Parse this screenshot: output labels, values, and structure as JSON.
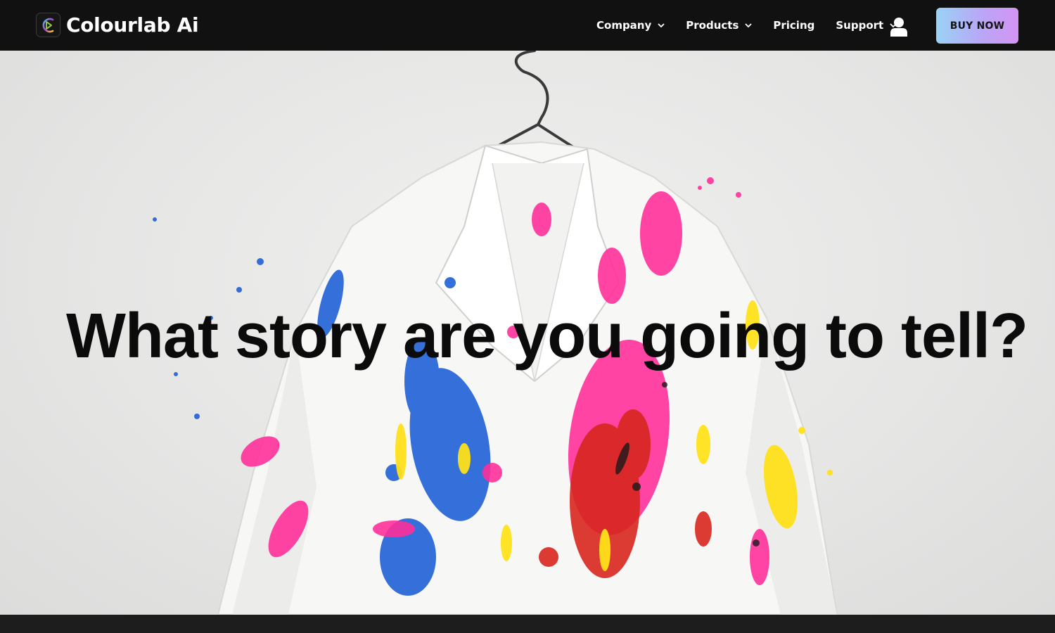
{
  "brand": {
    "name": "Colourlab Ai",
    "logo_icon": "colourlab-logo-icon"
  },
  "nav": {
    "items": [
      {
        "label": "Company",
        "has_dropdown": true
      },
      {
        "label": "Products",
        "has_dropdown": true
      },
      {
        "label": "Pricing",
        "has_dropdown": false
      },
      {
        "label": "Support",
        "has_dropdown": true
      }
    ],
    "account_icon": "user-icon",
    "buy_label": "BUY NOW"
  },
  "hero": {
    "title": "What story are you going to tell?",
    "image": "paint-splattered-white-jacket-on-hanger"
  },
  "colors": {
    "nav_bg": "#111111",
    "nav_text": "#ffffff",
    "buy_gradient": [
      "#9ad3f5",
      "#b9a6f6",
      "#d494f3"
    ],
    "hero_title": "#0b0b0b",
    "footer_bg": "#1d1d1d"
  }
}
